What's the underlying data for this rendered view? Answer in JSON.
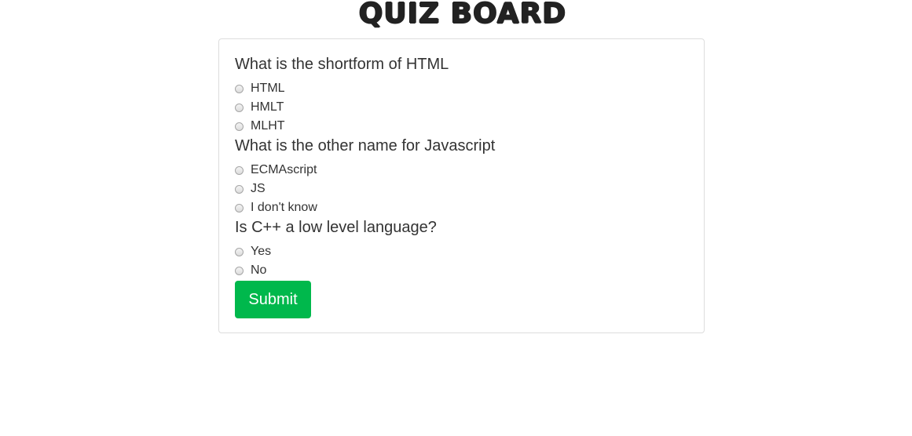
{
  "header": {
    "title": "QUIZ BOARD"
  },
  "quiz": {
    "questions": [
      {
        "text": "What is the shortform of HTML",
        "options": [
          "HTML",
          "HMLT",
          "MLHT"
        ]
      },
      {
        "text": "What is the other name for Javascript",
        "options": [
          "ECMAscript",
          "JS",
          "I don't know"
        ]
      },
      {
        "text": "Is C++ a low level language?",
        "options": [
          "Yes",
          "No"
        ]
      }
    ],
    "submit_label": "Submit"
  },
  "colors": {
    "submit_button": "#00b84c",
    "card_border": "#dddddd",
    "text": "#333333"
  }
}
